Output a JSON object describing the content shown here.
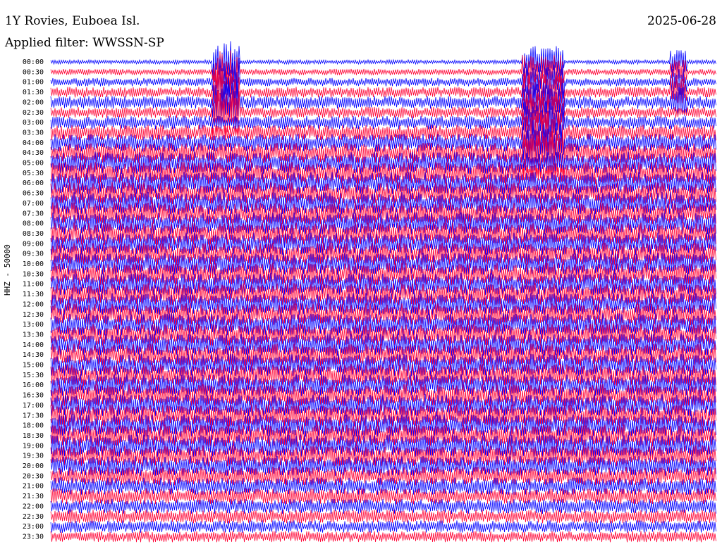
{
  "title": "1Y Rovies, Euboea Isl.",
  "subtitle": "Applied filter: WWSSN-SP",
  "date": "2025-06-28",
  "ylabel": "HHZ - 50000",
  "chart_data": {
    "type": "line",
    "subtype": "helicorder",
    "title": "1Y Rovies, Euboea Isl.",
    "date": "2025-06-28",
    "filter": "WWSSN-SP",
    "ylabel": "HHZ - 50000",
    "y_tick_labels": [
      "00:00",
      "00:30",
      "01:00",
      "01:30",
      "02:00",
      "02:30",
      "03:00",
      "03:30",
      "04:00",
      "04:30",
      "05:00",
      "05:30",
      "06:00",
      "06:30",
      "07:00",
      "07:30",
      "08:00",
      "08:30",
      "09:00",
      "09:30",
      "10:00",
      "10:30",
      "11:00",
      "11:30",
      "12:00",
      "12:30",
      "13:00",
      "13:30",
      "14:00",
      "14:30",
      "15:00",
      "15:30",
      "16:00",
      "16:30",
      "17:00",
      "17:30",
      "18:00",
      "18:30",
      "19:00",
      "19:30",
      "20:00",
      "20:30",
      "21:00",
      "21:30",
      "22:00",
      "22:30",
      "23:00",
      "23:30"
    ],
    "trace_colors": [
      "#0000ff",
      "#ff0033"
    ],
    "line_minutes": 30,
    "grid": false,
    "legend": "none"
  }
}
